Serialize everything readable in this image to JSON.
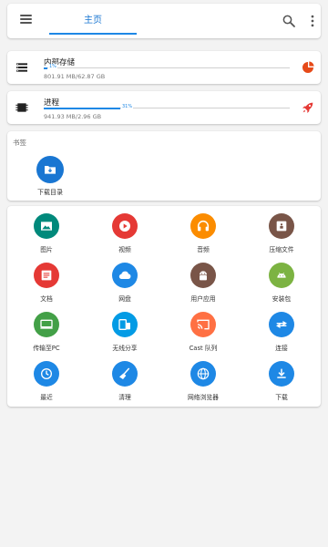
{
  "appbar": {
    "menu_icon": "menu-icon",
    "tab_label": "主页",
    "search_icon": "search-icon",
    "more_icon": "more-vert-icon",
    "accent": "#1976d2"
  },
  "storage": [
    {
      "title": "内部存储",
      "percent_label": "1%",
      "progress": 0.01,
      "size": "801.91 MB/62.87 GB",
      "icon": "storage-icon",
      "action_icon": "pie-chart-icon",
      "action_color": "#e64a19"
    },
    {
      "title": "进程",
      "percent_label": "31%",
      "progress": 0.31,
      "size": "941.93 MB/2.96 GB",
      "icon": "memory-chip-icon",
      "action_icon": "rocket-icon",
      "action_color": "#e53935"
    }
  ],
  "bookmarks": {
    "header": "书签",
    "items": [
      {
        "label": "下载目录",
        "icon": "download-folder-icon",
        "color": "#1976d2"
      }
    ]
  },
  "categories": [
    {
      "label": "图片",
      "icon": "image-icon",
      "color": "#00897b"
    },
    {
      "label": "视频",
      "icon": "play-icon",
      "color": "#e53935"
    },
    {
      "label": "音频",
      "icon": "headphones-icon",
      "color": "#fb8c00"
    },
    {
      "label": "压缩文件",
      "icon": "archive-icon",
      "color": "#795548"
    },
    {
      "label": "文档",
      "icon": "document-icon",
      "color": "#e53935"
    },
    {
      "label": "网盘",
      "icon": "cloud-icon",
      "color": "#1e88e5"
    },
    {
      "label": "用户应用",
      "icon": "android-icon",
      "color": "#795548"
    },
    {
      "label": "安装包",
      "icon": "apk-icon",
      "color": "#7cb342"
    },
    {
      "label": "传输至PC",
      "icon": "computer-icon",
      "color": "#43a047"
    },
    {
      "label": "无线分享",
      "icon": "devices-icon",
      "color": "#039be5"
    },
    {
      "label": "Cast 队列",
      "icon": "cast-icon",
      "color": "#ff7043"
    },
    {
      "label": "连接",
      "icon": "transfer-icon",
      "color": "#1e88e5"
    },
    {
      "label": "最近",
      "icon": "clock-icon",
      "color": "#1e88e5"
    },
    {
      "label": "清理",
      "icon": "broom-icon",
      "color": "#1e88e5"
    },
    {
      "label": "网络浏览器",
      "icon": "globe-icon",
      "color": "#1e88e5"
    },
    {
      "label": "下载",
      "icon": "download-icon",
      "color": "#1e88e5"
    }
  ]
}
